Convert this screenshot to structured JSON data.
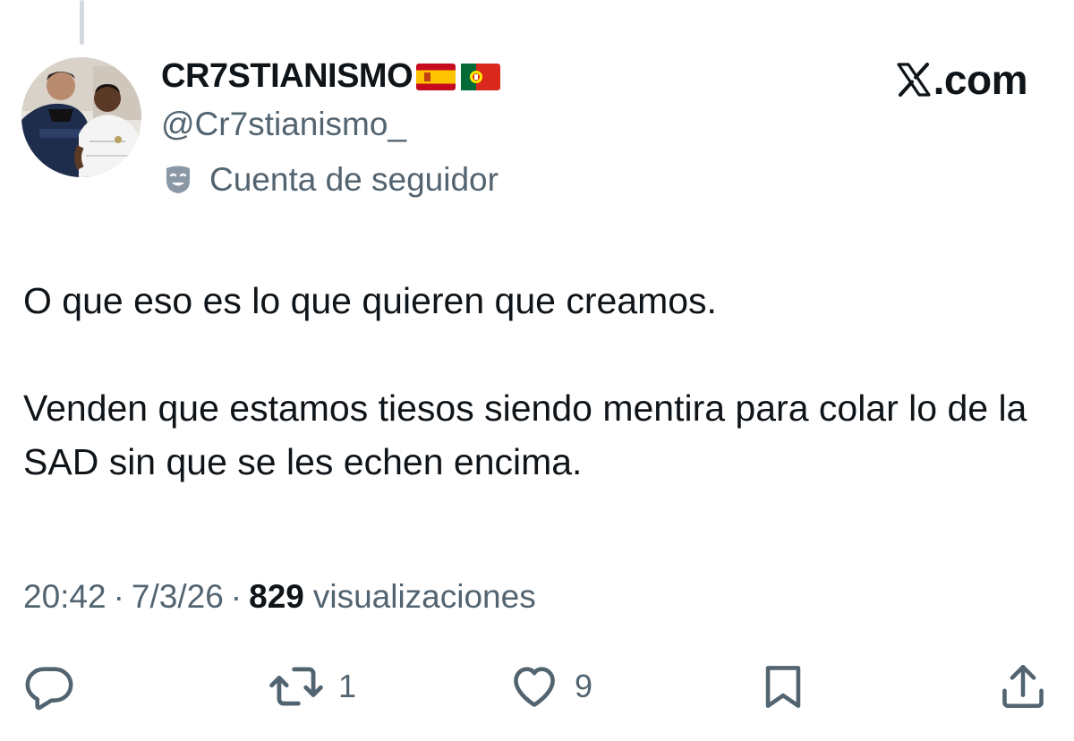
{
  "author": {
    "display_name": "CR7STIANISMO",
    "flags": [
      "spain-flag",
      "portugal-flag"
    ],
    "handle": "@Cr7stianismo_",
    "account_label": "Cuenta de seguidor",
    "account_label_icon": "theater-mask-icon"
  },
  "brand": {
    "text": ".com",
    "logo": "x-logo"
  },
  "tweet": {
    "paragraphs": [
      "O que eso es lo que quieren que creamos.",
      "Venden que estamos tiesos siendo mentira para colar lo de la SAD sin que se les echen encima."
    ]
  },
  "meta": {
    "time": "20:42",
    "separator": "·",
    "date": "7/3/26",
    "views_count": "829",
    "views_label": "visualizaciones"
  },
  "actions": {
    "reply": {
      "icon": "reply-icon",
      "count": ""
    },
    "retweet": {
      "icon": "retweet-icon",
      "count": "1"
    },
    "like": {
      "icon": "heart-icon",
      "count": "9"
    },
    "bookmark": {
      "icon": "bookmark-icon"
    },
    "share": {
      "icon": "share-icon"
    }
  },
  "colors": {
    "text": "#0f1419",
    "secondary": "#536471",
    "thread_line": "#d3d9de"
  }
}
